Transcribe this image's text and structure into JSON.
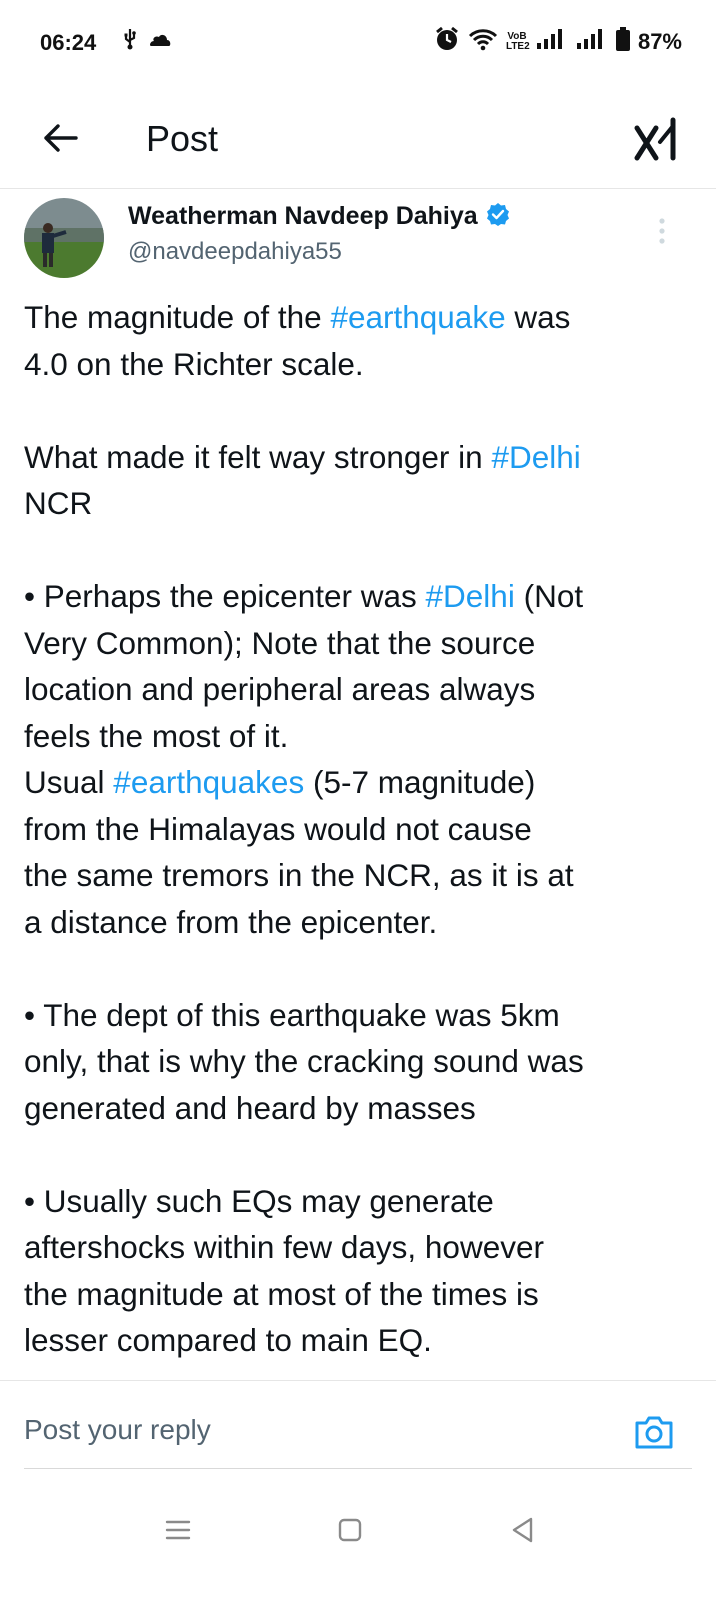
{
  "status_bar": {
    "time": "06:24",
    "battery": "87%",
    "network_badge_top": "VoB",
    "network_badge_bottom": "LTE2",
    "icons": [
      "usb-icon",
      "cloud-icon",
      "alarm-icon",
      "wifi-icon",
      "signal-icon",
      "signal-icon",
      "battery-icon"
    ]
  },
  "header": {
    "title": "Post",
    "back_icon": "arrow-left-icon",
    "logo_icon": "x-grok-icon"
  },
  "tweet": {
    "author_name": "Weatherman Navdeep Dahiya",
    "handle": "@navdeepdahiya55",
    "verified_color": "#1d9bf0",
    "paragraphs": [
      {
        "line1_pre": "The magnitude of the ",
        "line1_tag": "#earthquake",
        "line1_post": " was",
        "line2": "4.0 on the Richter scale."
      },
      {
        "pre": "What made it felt way stronger in ",
        "tag": "#Delhi",
        "line2": "NCR"
      },
      {
        "bullet_pre": "• Perhaps the epicenter was ",
        "bullet_tag": "#Delhi",
        "bullet_post": " (Not",
        "l2": "Very Common); Note that the source",
        "l3": "location and peripheral areas always",
        "l4": "feels the most of it.",
        "l5_pre": "Usual ",
        "l5_tag": "#earthquakes",
        "l5_post": " (5-7 magnitude)",
        "l6": "from the Himalayas would not cause",
        "l7": "the same tremors in the NCR, as it is at",
        "l8": "a distance from the epicenter."
      },
      {
        "l1": "• The dept of this earthquake was 5km",
        "l2": "only, that is why the cracking sound was",
        "l3": "generated and heard by masses"
      },
      {
        "l1": "• Usually such EQs may generate",
        "l2": "aftershocks within few days, however",
        "l3": "the magnitude at most of the times is",
        "l4": "lesser compared to main EQ."
      }
    ]
  },
  "reply": {
    "placeholder": "Post your reply"
  },
  "colors": {
    "hashtag": "#1d9bf0",
    "text": "#0f1419",
    "secondary": "#536471"
  }
}
